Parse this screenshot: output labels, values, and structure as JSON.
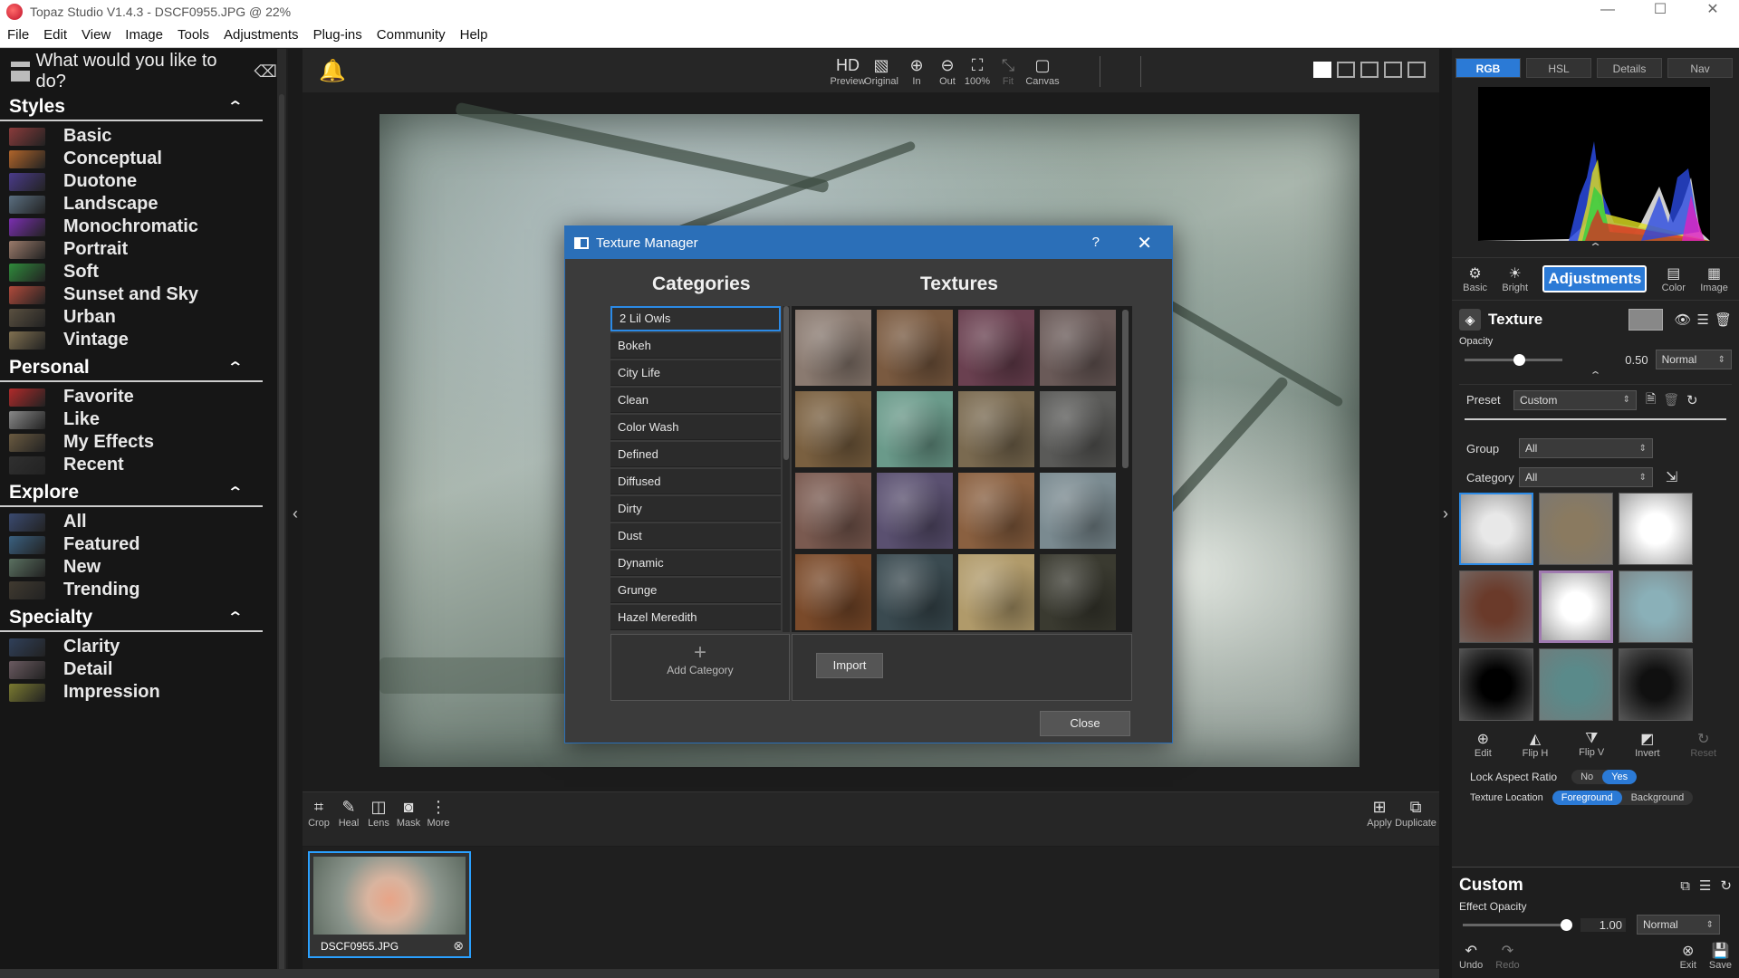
{
  "window": {
    "title": "Topaz Studio V1.4.3 - DSCF0955.JPG @ 22%",
    "controls": [
      "—",
      "☐",
      "✕"
    ]
  },
  "menu": [
    "File",
    "Edit",
    "View",
    "Image",
    "Tools",
    "Adjustments",
    "Plug-ins",
    "Community",
    "Help"
  ],
  "left_panel": {
    "search_placeholder": "What would you like to do?",
    "sections": [
      {
        "title": "Styles",
        "items": [
          {
            "label": "Basic",
            "color": "#8a3b3b"
          },
          {
            "label": "Conceptual",
            "color": "#b0642a"
          },
          {
            "label": "Duotone",
            "color": "#4a3b8a"
          },
          {
            "label": "Landscape",
            "color": "#5a6e80"
          },
          {
            "label": "Monochromatic",
            "color": "#7a2fb0"
          },
          {
            "label": "Portrait",
            "color": "#9a7a6a"
          },
          {
            "label": "Soft",
            "color": "#2f8a3b"
          },
          {
            "label": "Sunset and Sky",
            "color": "#b04a3b"
          },
          {
            "label": "Urban",
            "color": "#5a5040"
          },
          {
            "label": "Vintage",
            "color": "#807050"
          }
        ]
      },
      {
        "title": "Personal",
        "items": [
          {
            "label": "Favorite",
            "color": "#b02a2a"
          },
          {
            "label": "Like",
            "color": "#888888"
          },
          {
            "label": "My Effects",
            "color": "#6a5a40"
          },
          {
            "label": "Recent",
            "color": "#303030"
          }
        ]
      },
      {
        "title": "Explore",
        "items": [
          {
            "label": "All",
            "color": "#3a4a70"
          },
          {
            "label": "Featured",
            "color": "#3a6080"
          },
          {
            "label": "New",
            "color": "#5a7060"
          },
          {
            "label": "Trending",
            "color": "#403a30"
          }
        ]
      },
      {
        "title": "Specialty",
        "items": [
          {
            "label": "Clarity",
            "color": "#30405a"
          },
          {
            "label": "Detail",
            "color": "#6a5a60"
          },
          {
            "label": "Impression",
            "color": "#7a7a30"
          }
        ]
      }
    ]
  },
  "toolbar": {
    "buttons": [
      {
        "label": "Preview",
        "icon": "HD"
      },
      {
        "label": "Original",
        "icon": "▧"
      },
      {
        "label": "In",
        "icon": "⊕"
      },
      {
        "label": "Out",
        "icon": "⊖"
      },
      {
        "label": "100%",
        "icon": "⛶"
      },
      {
        "label": "Fit",
        "icon": "⤡"
      },
      {
        "label": "Canvas",
        "icon": "▢"
      }
    ]
  },
  "bottom_tools": {
    "left": [
      {
        "label": "Crop",
        "icon": "⌗"
      },
      {
        "label": "Heal",
        "icon": "✎"
      },
      {
        "label": "Lens",
        "icon": "◫"
      },
      {
        "label": "Mask",
        "icon": "◙"
      },
      {
        "label": "More",
        "icon": "⋮"
      }
    ],
    "right": [
      {
        "label": "Apply",
        "icon": "⊞"
      },
      {
        "label": "Duplicate",
        "icon": "⧉"
      }
    ]
  },
  "filmstrip": {
    "filename": "DSCF0955.JPG"
  },
  "dialog": {
    "title": "Texture Manager",
    "help": "?",
    "categories_heading": "Categories",
    "textures_heading": "Textures",
    "categories": [
      "2 Lil Owls",
      "Bokeh",
      "City Life",
      "Clean",
      "Color Wash",
      "Defined",
      "Diffused",
      "Dirty",
      "Dust",
      "Dynamic",
      "Grunge",
      "Hazel Meredith"
    ],
    "selected_category": "2 Lil Owls",
    "texture_colors": [
      "#8a7a70",
      "#7a5a40",
      "#6a4050",
      "#6a5a58",
      "#7a6040",
      "#6a9a8a",
      "#7a6a50",
      "#5a5a58",
      "#7a5a50",
      "#5a5070",
      "#8a6040",
      "#7a8a90",
      "#7a4a2a",
      "#3a4a50",
      "#b09a6a",
      "#3a3a30"
    ],
    "add_category_label": "Add Category",
    "import_label": "Import",
    "close_label": "Close"
  },
  "right_panel": {
    "hist_tabs": [
      "RGB",
      "HSL",
      "Details",
      "Nav"
    ],
    "active_hist_tab": "RGB",
    "adj_tabs": [
      {
        "label": "Basic",
        "icon": "⚙"
      },
      {
        "label": "Bright",
        "icon": "☀"
      },
      {
        "label": "Adjustments",
        "icon": ""
      },
      {
        "label": "Color",
        "icon": "▤"
      },
      {
        "label": "Image",
        "icon": "▦"
      }
    ],
    "texture": {
      "title": "Texture",
      "opacity_label": "Opacity",
      "opacity_value": "0.50",
      "opacity_fraction": 0.5,
      "blend_mode": "Normal",
      "preset_label": "Preset",
      "preset_value": "Custom",
      "group_label": "Group",
      "group_value": "All",
      "category_label": "Category",
      "category_value": "All",
      "thumb_colors": [
        "#e8e8e8",
        "#8a7a60",
        "#ffffff",
        "#6a3a2a",
        "#ffffff",
        "#8ab0b8",
        "#000000",
        "#5a8a8a",
        "#101010"
      ],
      "actions": [
        {
          "label": "Edit",
          "icon": "⊕"
        },
        {
          "label": "Flip H",
          "icon": "◭"
        },
        {
          "label": "Flip V",
          "icon": "⧩"
        },
        {
          "label": "Invert",
          "icon": "◩"
        },
        {
          "label": "Reset",
          "icon": "↻"
        }
      ],
      "lock_aspect_label": "Lock Aspect Ratio",
      "lock_no": "No",
      "lock_yes": "Yes",
      "texture_location_label": "Texture Location",
      "location_foreground": "Foreground",
      "location_background": "Background"
    },
    "custom": {
      "title": "Custom",
      "effect_opacity_label": "Effect Opacity",
      "effect_opacity_value": "1.00",
      "effect_opacity_fraction": 1.0,
      "blend_mode": "Normal",
      "undo": "Undo",
      "redo": "Redo",
      "exit": "Exit",
      "save": "Save"
    }
  }
}
